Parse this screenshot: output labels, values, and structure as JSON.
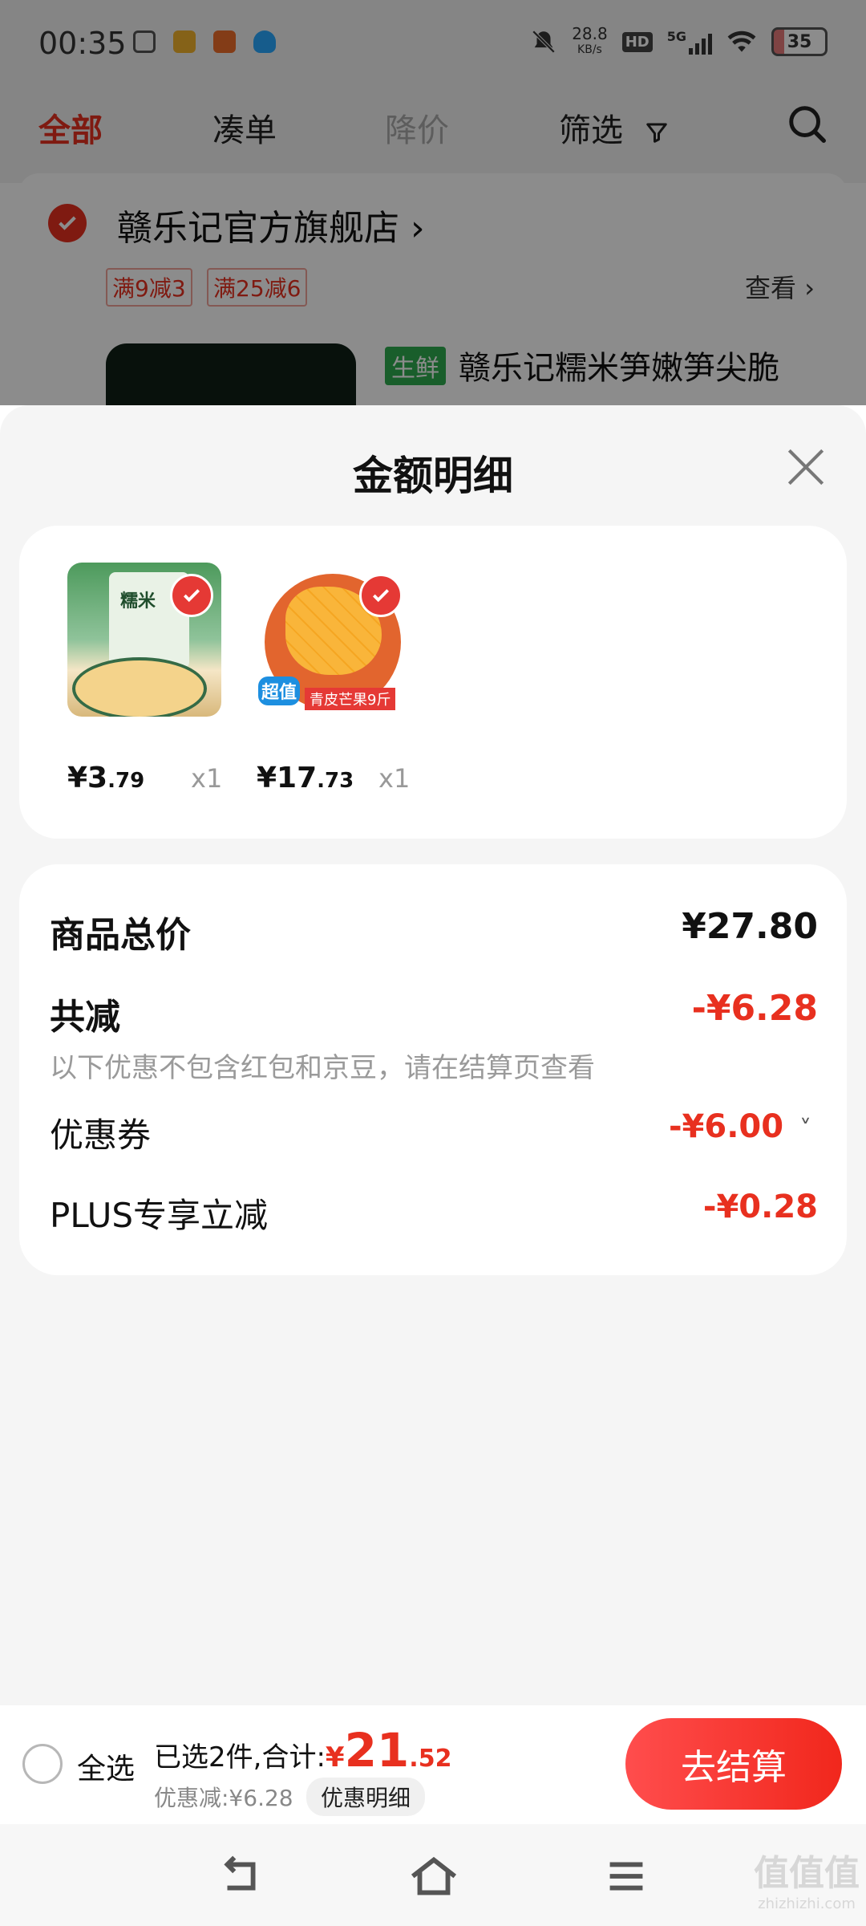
{
  "status": {
    "time": "00:35",
    "net_speed": "28.8",
    "net_unit": "KB/s",
    "hd": "HD",
    "signal": "5G",
    "battery": "35"
  },
  "tabs": [
    {
      "label": "全部",
      "active": true
    },
    {
      "label": "凑单",
      "active": false
    },
    {
      "label": "降价",
      "active": false
    },
    {
      "label": "筛选",
      "active": false
    }
  ],
  "store": {
    "name": "赣乐记官方旗舰店",
    "chevron": "›",
    "promos": [
      "满9减3",
      "满25减6"
    ],
    "view_label": "查看",
    "product_tag": "生鲜",
    "product_title": "赣乐记糯米笋嫩笋尖脆"
  },
  "sheet": {
    "title": "金额明细",
    "items": [
      {
        "price_int": "¥3",
        "price_dec": ".79",
        "qty": "x1"
      },
      {
        "price_int": "¥17",
        "price_dec": ".73",
        "qty": "x1"
      }
    ],
    "mango_badge": "超值",
    "mango_label": "青皮芒果9斤",
    "product_brand": "糯米",
    "total_label": "商品总价",
    "total_value": "¥27.80",
    "discount_label": "共减",
    "discount_value": "-¥6.28",
    "discount_note": "以下优惠不包含红包和京豆，请在结算页查看",
    "coupon_label": "优惠券",
    "coupon_value": "-¥6.00",
    "coupon_chevron": "˅",
    "plus_label": "PLUS专享立减",
    "plus_value": "-¥0.28"
  },
  "bottom": {
    "select_all": "全选",
    "selected_text": "已选2件,合计:",
    "currency": "¥",
    "total_int": "21",
    "total_dec": ".52",
    "saved_text": "优惠减:¥6.28",
    "detail_chip": "优惠明细",
    "checkout": "去结算"
  },
  "watermark": {
    "text": "值值值",
    "sub": "zhizhizhi.com"
  },
  "colors": {
    "accent": "#e8301f",
    "green_tag": "#2eab4f"
  }
}
